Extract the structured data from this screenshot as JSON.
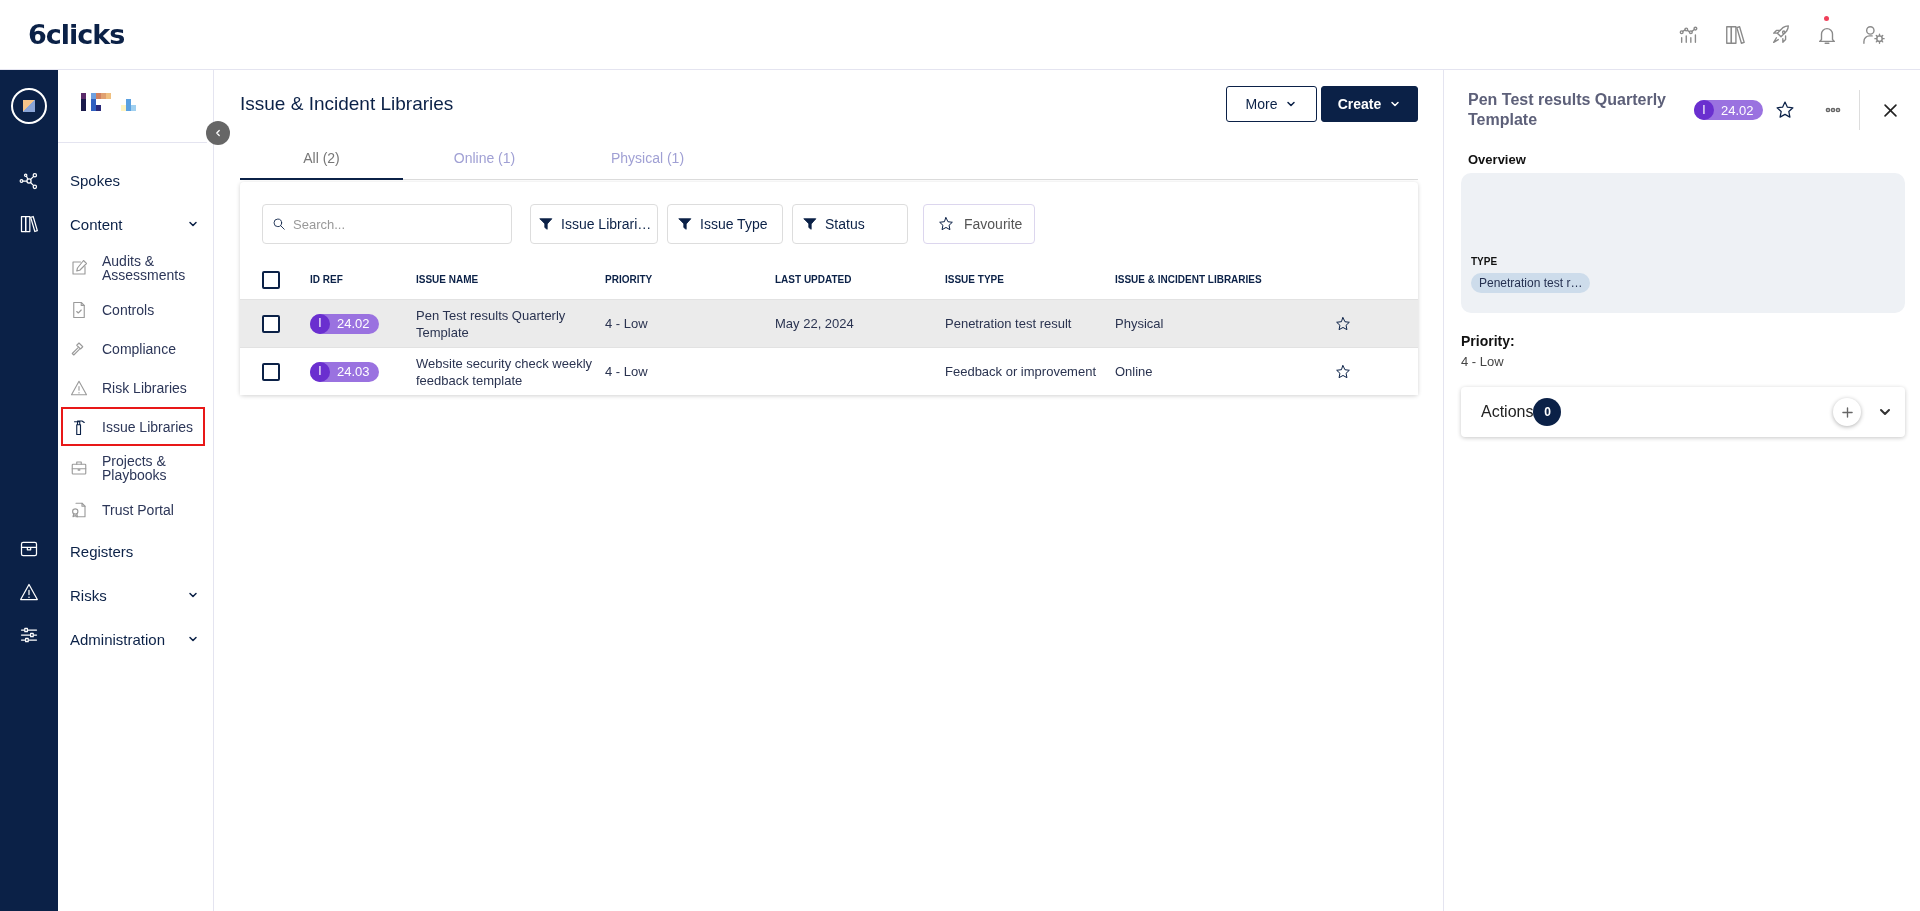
{
  "header": {
    "logo": "6clicks",
    "notifications_unread": true
  },
  "sidebar": {
    "items": [
      {
        "kind": "link",
        "label": "Spokes"
      },
      {
        "kind": "group",
        "label": "Content",
        "children": [
          {
            "label": "Audits & Assessments",
            "selected": false
          },
          {
            "label": "Controls",
            "selected": false
          },
          {
            "label": "Compliance",
            "selected": false
          },
          {
            "label": "Risk Libraries",
            "selected": false
          },
          {
            "label": "Issue Libraries",
            "selected": true
          },
          {
            "label": "Projects & Playbooks",
            "selected": false
          },
          {
            "label": "Trust Portal",
            "selected": false
          }
        ]
      },
      {
        "kind": "link",
        "label": "Registers"
      },
      {
        "kind": "group",
        "label": "Risks"
      },
      {
        "kind": "group",
        "label": "Administration"
      }
    ]
  },
  "main": {
    "title": "Issue & Incident Libraries",
    "buttons": [
      {
        "label": "More",
        "kind": "outline"
      },
      {
        "label": "Create",
        "kind": "primary"
      }
    ],
    "tabs": [
      {
        "label": "All (2)",
        "selected": true
      },
      {
        "label": "Online (1)",
        "selected": false
      },
      {
        "label": "Physical (1)",
        "selected": false
      }
    ],
    "search": {
      "placeholder": "Search..."
    },
    "filters": [
      {
        "label": "Issue Librari…",
        "kind": "filter"
      },
      {
        "label": "Issue Type",
        "kind": "filter"
      },
      {
        "label": "Status",
        "kind": "filter"
      },
      {
        "label": "Favourite",
        "kind": "favourite"
      }
    ],
    "table": {
      "select_all": {
        "checked": false
      },
      "columns": [
        "ID REF",
        "ISSUE NAME",
        "PRIORITY",
        "LAST UPDATED",
        "ISSUE TYPE",
        "ISSUE & INCIDENT LIBRARIES"
      ],
      "rows": [
        {
          "selected": true,
          "checked": false,
          "id_prefix": "I",
          "id": "24.02",
          "name": "Pen Test results Quarterly Template",
          "priority": "4 - Low",
          "last_updated": "May 22, 2024",
          "issue_type": "Penetration test result",
          "library": "Physical",
          "favourite": false
        },
        {
          "selected": false,
          "checked": false,
          "id_prefix": "I",
          "id": "24.03",
          "name": "Website security check weekly feedback template",
          "priority": "4 - Low",
          "issue_type": "Feedback or improvement",
          "library": "Online",
          "favourite": false
        }
      ]
    }
  },
  "detail": {
    "title": "Pen Test results Quarterly Template",
    "id_prefix": "I",
    "id": "24.02",
    "favourite": false,
    "overview_label": "Overview",
    "type_label": "TYPE",
    "type_value": "Penetration test r…",
    "priority_label": "Priority:",
    "priority_value": "4 - Low",
    "actions": {
      "label": "Actions",
      "count": "0",
      "expanded": false
    }
  }
}
